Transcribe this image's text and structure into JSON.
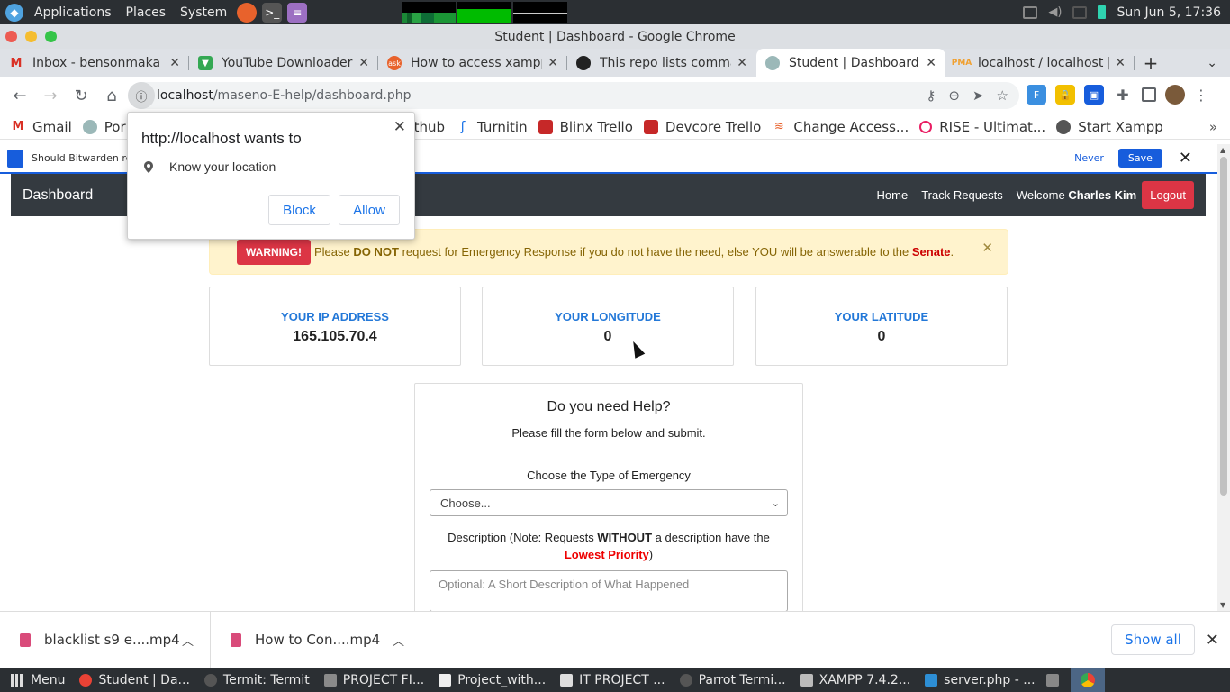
{
  "system_panel": {
    "menus": [
      "Applications",
      "Places",
      "System"
    ],
    "clock": "Sun Jun  5, 17:36"
  },
  "window_title": "Student | Dashboard - Google Chrome",
  "tabs": [
    {
      "label": "Inbox - bensonmaka",
      "color": "#d93025"
    },
    {
      "label": "YouTube Downloader",
      "color": "#34a853"
    },
    {
      "label": "How to access xampp",
      "color": "#e8622c"
    },
    {
      "label": "This repo lists comma",
      "color": "#222222"
    },
    {
      "label": "Student | Dashboard",
      "color": "#5f8a8b"
    },
    {
      "label": "localhost / localhost |",
      "color": "#f0a030"
    }
  ],
  "address": {
    "host": "localhost",
    "path": "/maseno-E-help/dashboard.php"
  },
  "bookmarks": [
    {
      "label": "Gmail",
      "color": "#d93025"
    },
    {
      "label": "Por",
      "color": "#5f8a8b"
    },
    {
      "label": "thub",
      "color": "#222222"
    },
    {
      "label": "Turnitin",
      "color": "#1a73e8"
    },
    {
      "label": "Blinx Trello",
      "color": "#c62828"
    },
    {
      "label": "Devcore Trello",
      "color": "#c62828"
    },
    {
      "label": "Change Access...",
      "color": "#e8622c"
    },
    {
      "label": "RISE - Ultimat...",
      "color": "#e91e63"
    },
    {
      "label": "Start Xampp",
      "color": "#444444"
    }
  ],
  "bitwarden": {
    "text": "Should Bitwarden rem",
    "never": "Never",
    "save": "Save"
  },
  "permission_popup": {
    "title": "http://localhost wants to",
    "item": "Know your location",
    "block": "Block",
    "allow": "Allow"
  },
  "navbar": {
    "brand": "Dashboard",
    "home": "Home",
    "track": "Track Requests",
    "welcome": "Welcome",
    "user": "Charles Kim",
    "logout": "Logout"
  },
  "alert": {
    "badge": "WARNING!",
    "pre": "Please",
    "bold": "DO NOT",
    "mid": "request for Emergency Response if you do not have the need, else YOU will be answerable to the",
    "senate": "Senate",
    "end": "."
  },
  "stats": {
    "ip_label": "YOUR IP ADDRESS",
    "ip_value": "165.105.70.4",
    "lon_label": "YOUR LONGITUDE",
    "lon_value": "0",
    "lat_label": "YOUR LATITUDE",
    "lat_value": "0"
  },
  "form": {
    "title": "Do you need Help?",
    "subtitle": "Please fill the form below and submit.",
    "type_label": "Choose the Type of Emergency",
    "select_value": "Choose...",
    "desc_pre": "Description (Note: Requests",
    "desc_bold": "WITHOUT",
    "desc_mid": "a description have the",
    "desc_red": "Lowest Priority",
    "desc_end": ")",
    "textarea_placeholder": "Optional: A Short Description of What Happened"
  },
  "downloads": {
    "items": [
      "blacklist s9 e....mp4",
      "How to Con....mp4"
    ],
    "show_all": "Show all"
  },
  "taskbar": {
    "menu": "Menu",
    "items": [
      {
        "label": "Student | Da...",
        "color": "#e94235"
      },
      {
        "label": "Termit: Termit",
        "color": "#555555"
      },
      {
        "label": "PROJECT FI...",
        "color": "#8a8a8a"
      },
      {
        "label": "Project_with...",
        "color": "#eeeeee"
      },
      {
        "label": "IT PROJECT ...",
        "color": "#dddddd"
      },
      {
        "label": "Parrot Termi...",
        "color": "#555555"
      },
      {
        "label": "XAMPP 7.4.2...",
        "color": "#bbbbbb"
      },
      {
        "label": "server.php - ...",
        "color": "#2d8fd6"
      }
    ]
  }
}
